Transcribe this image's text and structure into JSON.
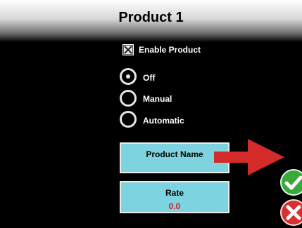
{
  "header": {
    "title": "Product 1"
  },
  "enable": {
    "label": "Enable Product",
    "checked": true
  },
  "mode": {
    "options": [
      "Off",
      "Manual",
      "Automatic"
    ],
    "selected": "Off"
  },
  "product_name_button": {
    "label": "Product Name",
    "value": ""
  },
  "rate_button": {
    "label": "Rate",
    "value": "0.0"
  },
  "actions": {
    "ok_icon": "checkmark-icon",
    "cancel_icon": "close-icon"
  },
  "colors": {
    "button_fill": "#7ed3e0",
    "rate_value": "#d41a1a",
    "arrow": "#d42a2a",
    "ok": "#3aa83a",
    "cancel": "#d43232"
  }
}
